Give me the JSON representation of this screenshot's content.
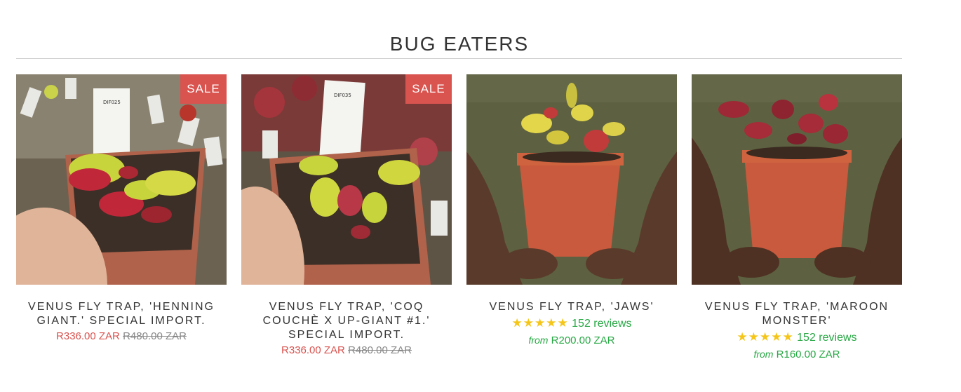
{
  "section": {
    "title": "BUG EATERS"
  },
  "products": [
    {
      "title": "VENUS FLY TRAP, 'HENNING GIANT.' SPECIAL IMPORT.",
      "badge": "SALE",
      "price": "R336.00 ZAR",
      "compare_price": "R480.00 ZAR",
      "tag_text": "DIF025"
    },
    {
      "title": "VENUS FLY TRAP, 'COQ COUCHÈ X UP-GIANT #1.' SPECIAL IMPORT.",
      "badge": "SALE",
      "price": "R336.00 ZAR",
      "compare_price": "R480.00 ZAR",
      "tag_text": "DIF035"
    },
    {
      "title": "VENUS FLY TRAP, 'JAWS'",
      "stars": "★★★★★",
      "reviews": "152 reviews",
      "from_label": "from",
      "price": "R200.00 ZAR"
    },
    {
      "title": "VENUS FLY TRAP, 'MAROON MONSTER'",
      "stars": "★★★★★",
      "reviews": "152 reviews",
      "from_label": "from",
      "price": "R160.00 ZAR"
    }
  ],
  "colors": {
    "sale": "#d9534f",
    "star": "#f5c518",
    "review_green": "#27a844",
    "divider": "#cfcfcf"
  }
}
